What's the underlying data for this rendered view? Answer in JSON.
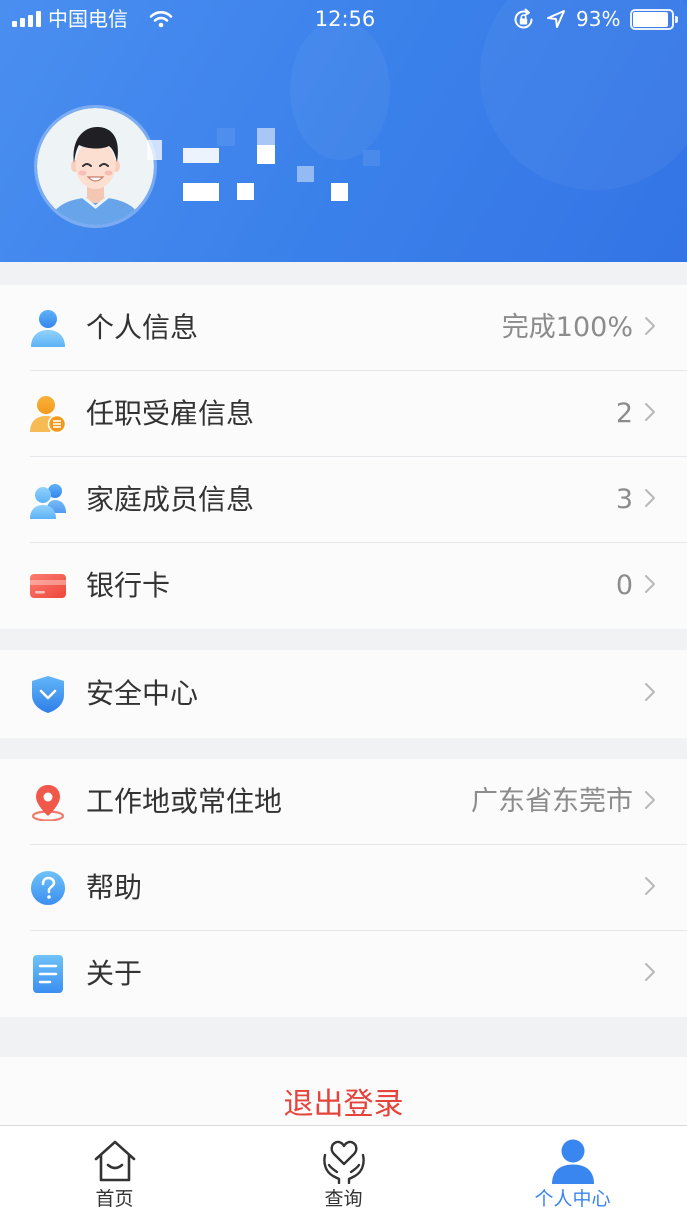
{
  "status_bar": {
    "carrier": "中国电信",
    "time": "12:56",
    "battery_text": "93%",
    "battery_level": 93,
    "signal_bars": 4,
    "icons": [
      "signal-icon",
      "wifi-icon",
      "orientation-lock-icon",
      "location-arrow-icon",
      "battery-icon"
    ]
  },
  "profile": {
    "avatar_icon": "avatar-icon"
  },
  "menu_groups": [
    [
      {
        "label": "个人信息",
        "value": "完成100%",
        "icon": "person-icon"
      },
      {
        "label": "任职受雇信息",
        "value": "2",
        "icon": "employee-badge-icon"
      },
      {
        "label": "家庭成员信息",
        "value": "3",
        "icon": "family-members-icon"
      },
      {
        "label": "银行卡",
        "value": "0",
        "icon": "bank-card-icon"
      }
    ],
    [
      {
        "label": "安全中心",
        "value": "",
        "icon": "shield-icon"
      }
    ],
    [
      {
        "label": "工作地或常住地",
        "value": "广东省东莞市",
        "icon": "location-pin-icon"
      },
      {
        "label": "帮助",
        "value": "",
        "icon": "help-icon"
      },
      {
        "label": "关于",
        "value": "",
        "icon": "document-icon"
      }
    ]
  ],
  "logout_label": "退出登录",
  "tabbar": [
    {
      "label": "首页",
      "icon": "home-icon",
      "active": false
    },
    {
      "label": "查询",
      "icon": "heart-hands-icon",
      "active": false
    },
    {
      "label": "个人中心",
      "icon": "user-icon",
      "active": true
    }
  ],
  "colors": {
    "header_blue": "#3a80ea",
    "page_bg": "#f1f2f4",
    "row_bg": "#fbfbfc",
    "label": "#333333",
    "value": "#8c8c8c",
    "chevron": "#b8b8b8",
    "logout_red": "#e6443a",
    "active_tab": "#3a86f0",
    "inactive_tab": "#333333"
  }
}
